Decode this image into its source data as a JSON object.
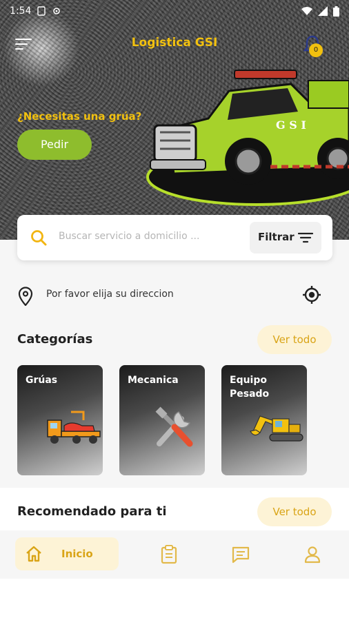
{
  "status_bar": {
    "time": "1:54"
  },
  "header": {
    "title": "Logistica GSI",
    "notification_count": "0"
  },
  "hero": {
    "question": "¿Necesitas una grúa?",
    "cta_label": "Pedir"
  },
  "search": {
    "placeholder": "Buscar servicio a domicilio ...",
    "filter_label": "Filtrar"
  },
  "location": {
    "prompt": "Por favor elija su direccion"
  },
  "categories": {
    "title": "Categorías",
    "see_all": "Ver todo",
    "items": [
      {
        "label": "Grúas",
        "icon": "tow-truck-icon"
      },
      {
        "label": "Mecanica",
        "icon": "tools-icon"
      },
      {
        "label": "Equipo Pesado",
        "icon": "excavator-icon"
      }
    ]
  },
  "recommended": {
    "title": "Recomendado para ti",
    "see_all": "Ver todo"
  },
  "bottom_nav": {
    "items": [
      {
        "label": "Inicio",
        "icon": "home-icon",
        "active": true
      },
      {
        "label": "",
        "icon": "clipboard-icon",
        "active": false
      },
      {
        "label": "",
        "icon": "chat-icon",
        "active": false
      },
      {
        "label": "",
        "icon": "profile-icon",
        "active": false
      }
    ]
  },
  "colors": {
    "accent": "#f2c10f",
    "accent_text": "#d9a416",
    "accent_soft": "#fdf3d6",
    "cta_green": "#8ebd2d",
    "truck_green": "#a6d22b"
  }
}
